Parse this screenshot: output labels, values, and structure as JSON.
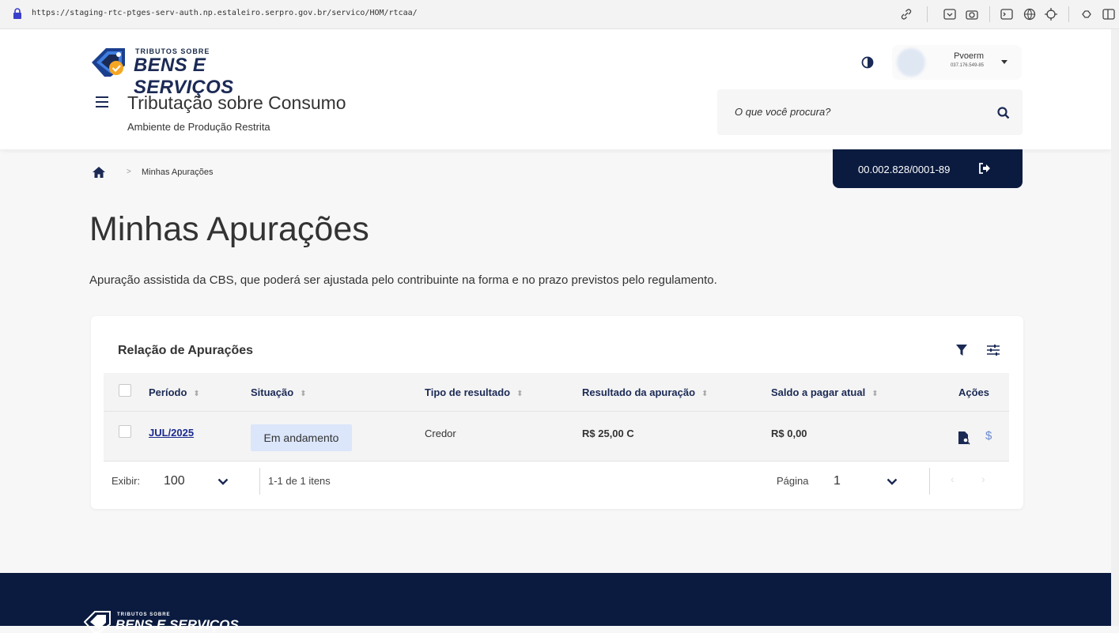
{
  "browser": {
    "url": "https://staging-rtc-ptges-serv-auth.np.estaleiro.serpro.gov.br/servico/HOM/rtcaa/"
  },
  "header": {
    "logo_small": "TRIBUTOS SOBRE",
    "logo_big": "BENS E SERVIÇOS",
    "app_title": "Tributação sobre Consumo",
    "app_subtitle": "Ambiente de Produção Restrita",
    "user": {
      "name": "Pvoerm",
      "document": "037.176.549-85"
    },
    "search_placeholder": "O que você procura?",
    "cnpj": "00.002.828/0001-89"
  },
  "breadcrumb": {
    "separator": ">",
    "current": "Minhas Apurações"
  },
  "page": {
    "title": "Minhas Apurações",
    "description": "Apuração assistida da CBS, que poderá ser ajustada pelo contribuinte na forma e no prazo previstos pelo regulamento."
  },
  "table": {
    "title": "Relação de Apurações",
    "columns": [
      "Período",
      "Situação",
      "Tipo de resultado",
      "Resultado da apuração",
      "Saldo a pagar atual",
      "Ações"
    ],
    "sort_symbol": "⬍",
    "rows": [
      {
        "periodo": "JUL/2025",
        "situacao": "Em andamento",
        "tipo": "Credor",
        "resultado": "R$ 25,00 C",
        "saldo": "R$ 0,00",
        "dollar": "$"
      }
    ]
  },
  "pagination": {
    "show_label": "Exibir:",
    "page_size": "100",
    "range_text": "1-1 de 1 itens",
    "page_label": "Página",
    "page": "1",
    "prev": "‹",
    "next": "›"
  },
  "footer": {
    "logo_small": "TRIBUTOS SOBRE",
    "logo_big": "BENS E SERVIÇOS"
  },
  "colors": {
    "navy": "#0b1b3f",
    "brand_blue": "#1b2a55",
    "badge_bg": "#dbe6fb",
    "link": "#1b2a8f",
    "logo_orange": "#f5a623"
  }
}
